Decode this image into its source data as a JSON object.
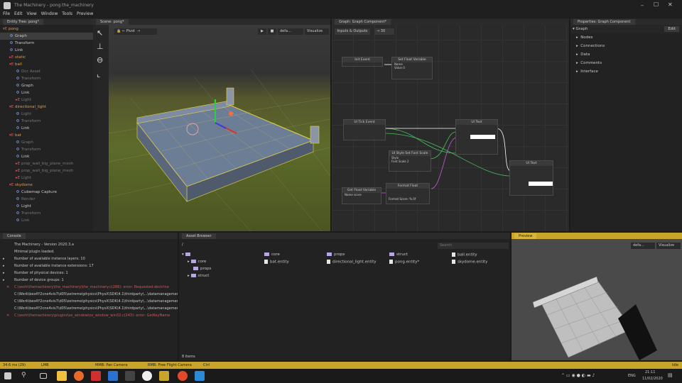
{
  "window": {
    "title": "The Machinery - pong.the_machinery"
  },
  "menu": [
    "File",
    "Edit",
    "View",
    "Window",
    "Tools",
    "Preview"
  ],
  "entity_tree": {
    "tab": "Entity Tree: pong*",
    "rows": [
      {
        "label": "pong",
        "kind": "entity",
        "level": 0,
        "expanded": true,
        "selected": false
      },
      {
        "label": "Graph",
        "kind": "component",
        "level": 1,
        "selected": true
      },
      {
        "label": "Transform",
        "kind": "component",
        "level": 1
      },
      {
        "label": "Link",
        "kind": "component",
        "level": 1
      },
      {
        "label": "static",
        "kind": "entity",
        "level": 1
      },
      {
        "label": "ball",
        "kind": "entity",
        "level": 1,
        "expanded": true
      },
      {
        "label": "Dcc Asset",
        "kind": "component",
        "level": 2,
        "dim": true
      },
      {
        "label": "Transform",
        "kind": "component",
        "level": 2,
        "dim": true
      },
      {
        "label": "Graph",
        "kind": "component",
        "level": 2
      },
      {
        "label": "Link",
        "kind": "component",
        "level": 2
      },
      {
        "label": "Light",
        "kind": "entity",
        "level": 2,
        "dim": true
      },
      {
        "label": "directional_light",
        "kind": "entity",
        "level": 1,
        "expanded": true
      },
      {
        "label": "Light",
        "kind": "component",
        "level": 2,
        "dim": true
      },
      {
        "label": "Transform",
        "kind": "component",
        "level": 2,
        "dim": true
      },
      {
        "label": "Link",
        "kind": "component",
        "level": 2
      },
      {
        "label": "bat",
        "kind": "entity",
        "level": 1,
        "expanded": true
      },
      {
        "label": "Graph",
        "kind": "component",
        "level": 2,
        "dim": true
      },
      {
        "label": "Transform",
        "kind": "component",
        "level": 2,
        "dim": true
      },
      {
        "label": "Link",
        "kind": "component",
        "level": 2
      },
      {
        "label": "prop_wall_big_plane_mesh",
        "kind": "entity",
        "level": 2,
        "dim": true
      },
      {
        "label": "prop_wall_big_plane_mesh",
        "kind": "entity",
        "level": 2,
        "dim": true
      },
      {
        "label": "Light",
        "kind": "entity",
        "level": 2,
        "dim": true
      },
      {
        "label": "skydome",
        "kind": "entity",
        "level": 1,
        "expanded": true
      },
      {
        "label": "Cubemap Capture",
        "kind": "component",
        "level": 2
      },
      {
        "label": "Render",
        "kind": "component",
        "level": 2,
        "dim": true
      },
      {
        "label": "Light",
        "kind": "component",
        "level": 2
      },
      {
        "label": "Transform",
        "kind": "component",
        "level": 2,
        "dim": true
      },
      {
        "label": "Link",
        "kind": "component",
        "level": 2,
        "dim": true
      }
    ]
  },
  "scene": {
    "tab": "Scene: pong*",
    "pivot": "Pivot",
    "default": "defa...",
    "visualize": "Visualize"
  },
  "graph": {
    "tab": "Graph: Graph Component*",
    "inputs": "Inputs & Outputs",
    "zoom": "30",
    "nodes": [
      {
        "title": "Init Event"
      },
      {
        "title": "Set Float Variable",
        "field1": "Name",
        "field2": "Value",
        "value": "0"
      },
      {
        "title": "UI Tick Event"
      },
      {
        "title": "UI Text"
      },
      {
        "title": "UI Style Set Font Scale",
        "field1": "Style",
        "field2": "Font Scale",
        "value": "2"
      },
      {
        "title": "UI Text"
      },
      {
        "title": "Get Float Variable",
        "field1": "Name",
        "value": "score"
      },
      {
        "title": "Format Float",
        "field1": "Format",
        "value": "Score: %.0f"
      }
    ]
  },
  "properties": {
    "tab": "Properties: Graph Component",
    "header": "Graph",
    "edit": "Edit",
    "sections": [
      "Nodes",
      "Connections",
      "Data",
      "Comments",
      "Interface"
    ]
  },
  "console": {
    "tab": "Console",
    "lines": [
      {
        "text": "The Machinery - Version 2020.3.a",
        "type": "info"
      },
      {
        "text": "Minimal plugin loaded.",
        "type": "info"
      },
      {
        "text": "Number of available instance layers: 10",
        "type": "info",
        "arrow": true
      },
      {
        "text": "Number of available instance extensions: 17",
        "type": "info",
        "arrow": true
      },
      {
        "text": "Number of physical devices: 1",
        "type": "info",
        "arrow": true
      },
      {
        "text": "Number of device groups: 1",
        "type": "info",
        "arrow": true
      },
      {
        "text": "C:\\work\\themachinery\\the_machinery\\the_machinery.c(286): error: Requested-doctrine",
        "type": "error"
      },
      {
        "text": "C:\\Work\\bes4Y2cne4vis7\\d05\\extreme\\physics\\PhysX\\SDK\\4.1\\thirdparty\\...\\datamanagement\\Phy",
        "type": "info"
      },
      {
        "text": "C:\\Work\\bes4Y2cne4vis7\\d05\\extreme\\physics\\PhysX\\SDK\\4.1\\thirdparty\\...\\datamanagement\\Lua",
        "type": "info"
      },
      {
        "text": "C:\\Work\\bes4Y2cne4vis7\\d05\\extreme\\physics\\PhysX\\SDK\\4.1\\thirdparty\\...\\datamanagement\\Lua",
        "type": "info"
      },
      {
        "text": "C:\\work\\themachinery\\plugins\\os_window\\os_window_win32.c(243): error: GetKeyName",
        "type": "error"
      }
    ]
  },
  "asset_browser": {
    "tab": "Asset Browser",
    "path": "/",
    "search_placeholder": "Search",
    "tree": [
      "core",
      "props",
      "struct"
    ],
    "grid": [
      {
        "label": "core",
        "kind": "folder"
      },
      {
        "label": "props",
        "kind": "folder"
      },
      {
        "label": "struct",
        "kind": "folder"
      },
      {
        "label": "ball.entity",
        "kind": "file"
      },
      {
        "label": "bat.entity",
        "kind": "file"
      },
      {
        "label": "directional_light.entity",
        "kind": "file"
      },
      {
        "label": "pong.entity*",
        "kind": "file"
      },
      {
        "label": "skydome.entity",
        "kind": "file"
      }
    ],
    "count": "8 items"
  },
  "preview": {
    "tab": "Preview",
    "default": "defa...",
    "visualize": "Visualize"
  },
  "status": {
    "fps": "34.6 ms (29)",
    "lmb": "LMB",
    "mmb": "MMB: Pan Camera",
    "rmb": "RMB: Free Flight Camera",
    "ctrl": "Ctrl",
    "right": "Idle"
  },
  "taskbar": {
    "lang": "ENG",
    "time": "21:11",
    "date": "11/02/2020"
  },
  "colors": {
    "accent": "#c9a42a",
    "selection": "#3d3d3d",
    "wireframe": "#e8d24a"
  }
}
